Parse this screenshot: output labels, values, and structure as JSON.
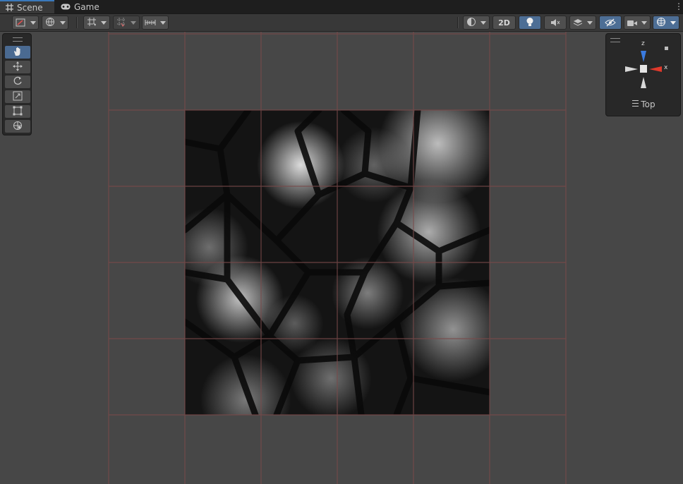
{
  "tabs": [
    {
      "label": "Scene",
      "icon": "hash-grid-icon",
      "active": true
    },
    {
      "label": "Game",
      "icon": "gamepad-icon",
      "active": false
    }
  ],
  "toolbar": {
    "left_groups": [
      "draw-mode-icon",
      "global-local-icon",
      "grid-snap-icon",
      "increment-snap-icon",
      "ruler-icon"
    ],
    "right_groups": [
      "shading-mode-icon",
      "2d-toggle",
      "lighting-icon",
      "audio-mute-icon",
      "effects-icon",
      "hidden-objects-icon",
      "camera-icon",
      "gizmos-icon"
    ],
    "label_2d": "2D"
  },
  "tools": [
    "hand-tool-icon",
    "move-tool-icon",
    "rotate-tool-icon",
    "scale-tool-icon",
    "rect-tool-icon",
    "transform-tool-icon"
  ],
  "gizmo": {
    "view_label": "Top",
    "axis_z": "z",
    "axis_x": "x",
    "colors": {
      "x": "#e0392b",
      "z": "#3a7be0",
      "y": "#d8d8d8"
    }
  },
  "colors": {
    "accent": "#4d6e95",
    "grid_line": "#7a4a4a",
    "viewport_bg": "#474747"
  }
}
